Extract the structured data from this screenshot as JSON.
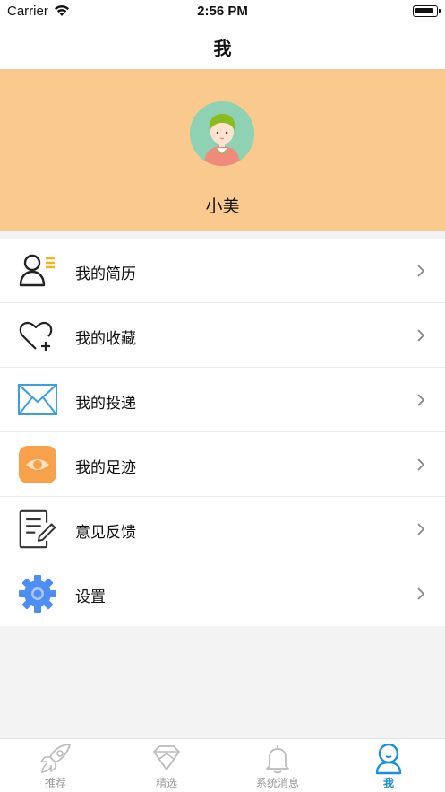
{
  "status_bar": {
    "carrier": "Carrier",
    "time": "2:56 PM"
  },
  "nav": {
    "title": "我"
  },
  "profile": {
    "name": "小美"
  },
  "menu": {
    "items": [
      {
        "label": "我的简历",
        "icon": "resume-icon"
      },
      {
        "label": "我的收藏",
        "icon": "favorite-heart-icon"
      },
      {
        "label": "我的投递",
        "icon": "envelope-icon"
      },
      {
        "label": "我的足迹",
        "icon": "eye-icon"
      },
      {
        "label": "意见反馈",
        "icon": "feedback-document-icon"
      },
      {
        "label": "设置",
        "icon": "gear-icon"
      }
    ]
  },
  "tabs": [
    {
      "label": "推荐",
      "icon": "rocket-icon",
      "active": false
    },
    {
      "label": "精选",
      "icon": "diamond-icon",
      "active": false
    },
    {
      "label": "系统消息",
      "icon": "bell-icon",
      "active": false
    },
    {
      "label": "我",
      "icon": "user-icon",
      "active": true
    }
  ],
  "colors": {
    "profile_bg": "#f9c98d",
    "accent": "#1a8fdc",
    "avatar_bg": "#8fd1b3"
  }
}
